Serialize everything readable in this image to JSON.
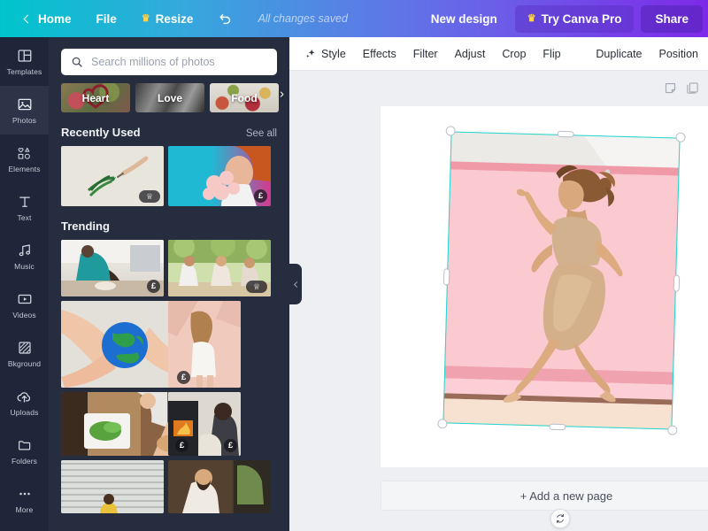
{
  "topbar": {
    "home_label": "Home",
    "file_label": "File",
    "resize_label": "Resize",
    "undo_name": "undo-icon",
    "save_status": "All changes saved",
    "new_design_label": "New design",
    "try_pro_label": "Try Canva Pro",
    "share_label": "Share",
    "gradient_start": "#00c4cc",
    "gradient_end": "#7d2ae8"
  },
  "sidebar": {
    "items": [
      {
        "label": "Templates",
        "icon": "templates-icon",
        "active": false
      },
      {
        "label": "Photos",
        "icon": "photos-icon",
        "active": true
      },
      {
        "label": "Elements",
        "icon": "elements-icon",
        "active": false
      },
      {
        "label": "Text",
        "icon": "text-icon",
        "active": false
      },
      {
        "label": "Music",
        "icon": "music-icon",
        "active": false
      },
      {
        "label": "Videos",
        "icon": "videos-icon",
        "active": false
      },
      {
        "label": "Bkground",
        "icon": "background-icon",
        "active": false
      },
      {
        "label": "Uploads",
        "icon": "uploads-icon",
        "active": false
      },
      {
        "label": "Folders",
        "icon": "folders-icon",
        "active": false
      },
      {
        "label": "More",
        "icon": "more-icon",
        "active": false
      }
    ]
  },
  "panel": {
    "search": {
      "placeholder": "Search millions of photos",
      "value": "",
      "icon": "search-icon"
    },
    "chips": [
      {
        "label": "Heart"
      },
      {
        "label": "Love"
      },
      {
        "label": "Food"
      }
    ],
    "chips_next_icon": "chevron-right-icon",
    "recently_used": {
      "title": "Recently Used",
      "see_all": "See all",
      "items": [
        {
          "name": "palm-leaf-hand-photo",
          "badge": "crown",
          "badge_text": "♕"
        },
        {
          "name": "woman-flowers-photo",
          "badge": "pound",
          "badge_text": "£"
        }
      ]
    },
    "trending": {
      "title": "Trending",
      "items": [
        {
          "name": "man-kitchen-photo",
          "badge": "pound",
          "badge_text": "£"
        },
        {
          "name": "friends-dinner-photo",
          "badge": "crown",
          "badge_text": "♕"
        },
        {
          "name": "hands-globe-photo",
          "badge": "pound",
          "badge_text": "£"
        },
        {
          "name": "woman-wall-shadow-photo",
          "badge": "none",
          "badge_text": ""
        },
        {
          "name": "salad-preparation-photo",
          "badge": "pound",
          "badge_text": "£"
        },
        {
          "name": "fireplace-couple-photo",
          "badge": "pound",
          "badge_text": "£"
        },
        {
          "name": "blinds-child-photo",
          "badge": "none",
          "badge_text": ""
        },
        {
          "name": "shopkeeper-photo",
          "badge": "none",
          "badge_text": ""
        }
      ]
    },
    "collapse_icon": "chevron-left-icon"
  },
  "editor_toolbar": {
    "left_items": [
      {
        "label": "Style",
        "icon": "sparkle-icon"
      },
      {
        "label": "Effects",
        "icon": ""
      },
      {
        "label": "Filter",
        "icon": ""
      },
      {
        "label": "Adjust",
        "icon": ""
      },
      {
        "label": "Crop",
        "icon": ""
      },
      {
        "label": "Flip",
        "icon": ""
      }
    ],
    "right_items": [
      {
        "label": "Duplicate",
        "icon": ""
      },
      {
        "label": "Position",
        "icon": ""
      }
    ]
  },
  "canvas": {
    "note_icon": "note-icon",
    "duplicate_page_icon": "duplicate-page-icon",
    "selection": {
      "name": "selected-image",
      "description": "woman-running-pink-backdrop-photo",
      "rotation_deg": 1.6,
      "handle_color": "#21d6cf"
    },
    "rotate_icon": "rotate-icon",
    "add_page_label": "+ Add a new page"
  }
}
